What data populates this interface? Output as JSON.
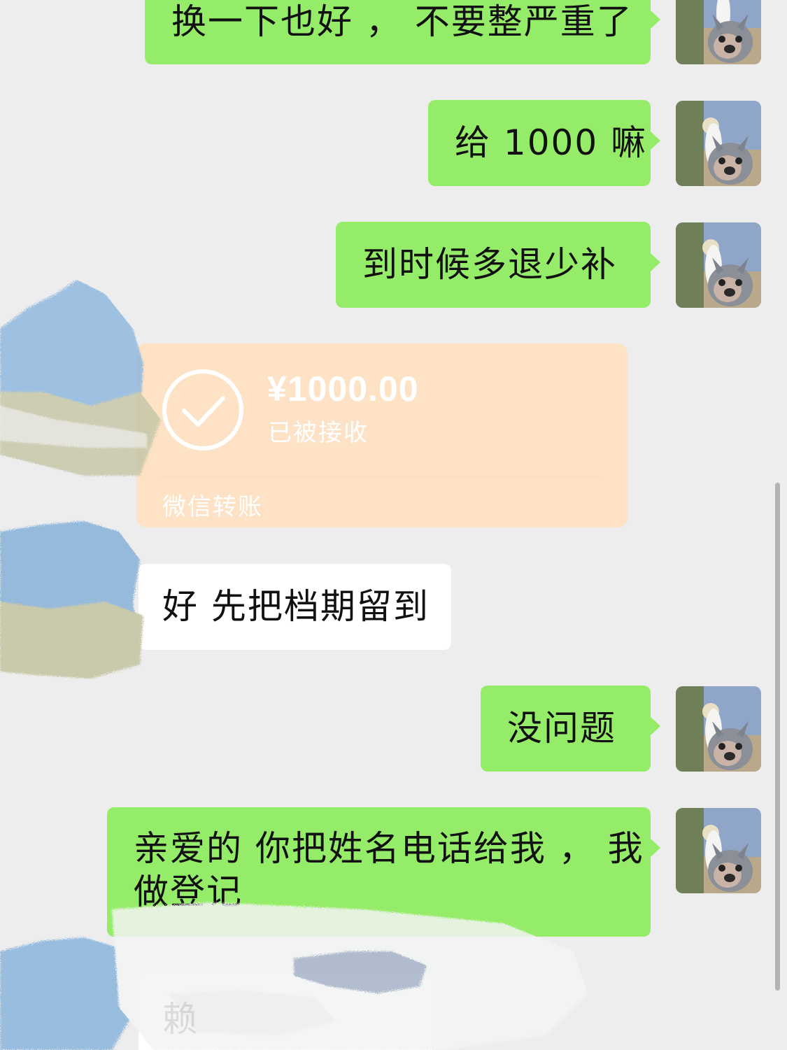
{
  "messages": [
    {
      "direction": "out",
      "text": "换一下也好 ， 不要整严重了"
    },
    {
      "direction": "out",
      "text": "给 1000 嘛"
    },
    {
      "direction": "out",
      "text": "到时候多退少补"
    },
    {
      "direction": "in",
      "type": "transfer",
      "amount": "¥1000.00",
      "status": "已被接收",
      "footer": "微信转账"
    },
    {
      "direction": "in",
      "text": "好 先把档期留到"
    },
    {
      "direction": "out",
      "text": "没问题"
    },
    {
      "direction": "out",
      "text_line1": "亲爱的 你把姓名电话给我 ， 我",
      "text_line2": "做登记"
    },
    {
      "direction": "in",
      "text_partial": "赖"
    }
  ],
  "colors": {
    "background": "#ededed",
    "outgoing_bubble": "#95ec69",
    "incoming_bubble": "#ffffff",
    "transfer_card": "#fde2c6"
  },
  "icons": {
    "avatar": "avatar-photo-dog",
    "transfer": "check-circle-icon"
  }
}
